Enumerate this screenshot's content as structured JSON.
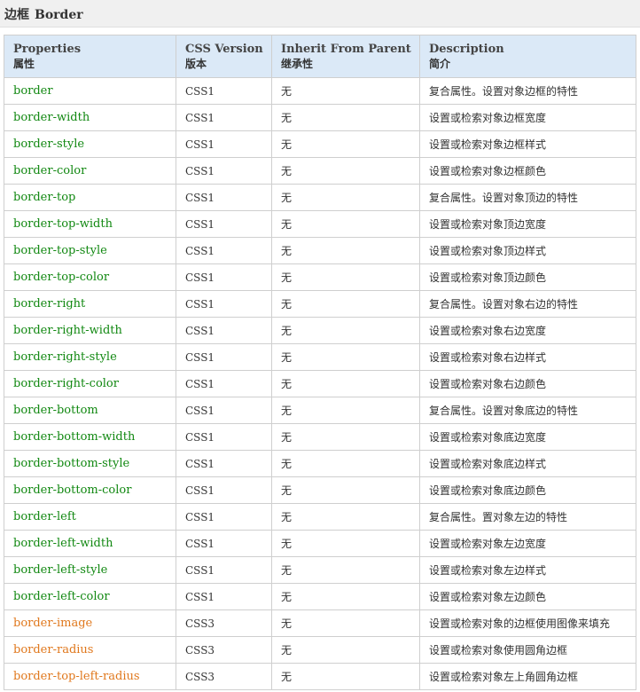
{
  "section": {
    "title_zh": "边框",
    "title_en": "Border"
  },
  "colors": {
    "css1_property": "#118811",
    "css3_property": "#e0781d",
    "header_bg": "#dbe9f7"
  },
  "table": {
    "headers": [
      {
        "en": "Properties",
        "zh": "属性"
      },
      {
        "en": "CSS Version",
        "zh": "版本"
      },
      {
        "en": "Inherit From Parent",
        "zh": "继承性"
      },
      {
        "en": "Description",
        "zh": "简介"
      }
    ],
    "rows": [
      {
        "property": "border",
        "version": "CSS1",
        "inherit": "无",
        "description": "复合属性。设置对象边框的特性"
      },
      {
        "property": "border-width",
        "version": "CSS1",
        "inherit": "无",
        "description": "设置或检索对象边框宽度"
      },
      {
        "property": "border-style",
        "version": "CSS1",
        "inherit": "无",
        "description": "设置或检索对象边框样式"
      },
      {
        "property": "border-color",
        "version": "CSS1",
        "inherit": "无",
        "description": "设置或检索对象边框颜色"
      },
      {
        "property": "border-top",
        "version": "CSS1",
        "inherit": "无",
        "description": "复合属性。设置对象顶边的特性"
      },
      {
        "property": "border-top-width",
        "version": "CSS1",
        "inherit": "无",
        "description": "设置或检索对象顶边宽度"
      },
      {
        "property": "border-top-style",
        "version": "CSS1",
        "inherit": "无",
        "description": "设置或检索对象顶边样式"
      },
      {
        "property": "border-top-color",
        "version": "CSS1",
        "inherit": "无",
        "description": "设置或检索对象顶边颜色"
      },
      {
        "property": "border-right",
        "version": "CSS1",
        "inherit": "无",
        "description": "复合属性。设置对象右边的特性"
      },
      {
        "property": "border-right-width",
        "version": "CSS1",
        "inherit": "无",
        "description": "设置或检索对象右边宽度"
      },
      {
        "property": "border-right-style",
        "version": "CSS1",
        "inherit": "无",
        "description": "设置或检索对象右边样式"
      },
      {
        "property": "border-right-color",
        "version": "CSS1",
        "inherit": "无",
        "description": "设置或检索对象右边颜色"
      },
      {
        "property": "border-bottom",
        "version": "CSS1",
        "inherit": "无",
        "description": "复合属性。设置对象底边的特性"
      },
      {
        "property": "border-bottom-width",
        "version": "CSS1",
        "inherit": "无",
        "description": "设置或检索对象底边宽度"
      },
      {
        "property": "border-bottom-style",
        "version": "CSS1",
        "inherit": "无",
        "description": "设置或检索对象底边样式"
      },
      {
        "property": "border-bottom-color",
        "version": "CSS1",
        "inherit": "无",
        "description": "设置或检索对象底边颜色"
      },
      {
        "property": "border-left",
        "version": "CSS1",
        "inherit": "无",
        "description": "复合属性。置对象左边的特性"
      },
      {
        "property": "border-left-width",
        "version": "CSS1",
        "inherit": "无",
        "description": "设置或检索对象左边宽度"
      },
      {
        "property": "border-left-style",
        "version": "CSS1",
        "inherit": "无",
        "description": "设置或检索对象左边样式"
      },
      {
        "property": "border-left-color",
        "version": "CSS1",
        "inherit": "无",
        "description": "设置或检索对象左边颜色"
      },
      {
        "property": "border-image",
        "version": "CSS3",
        "inherit": "无",
        "description": "设置或检索对象的边框使用图像来填充"
      },
      {
        "property": "border-radius",
        "version": "CSS3",
        "inherit": "无",
        "description": "设置或检索对象使用圆角边框"
      },
      {
        "property": "border-top-left-radius",
        "version": "CSS3",
        "inherit": "无",
        "description": "设置或检索对象左上角圆角边框"
      }
    ]
  }
}
